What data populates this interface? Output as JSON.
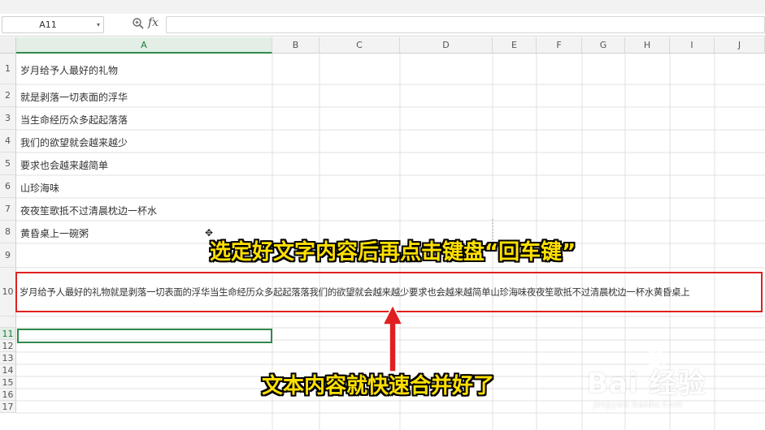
{
  "formula_bar": {
    "cell_ref": "A11",
    "fx_label": "fx"
  },
  "columns": [
    "A",
    "B",
    "C",
    "D",
    "E",
    "F",
    "G",
    "H",
    "I",
    "J"
  ],
  "rows": [
    "1",
    "2",
    "3",
    "4",
    "5",
    "6",
    "7",
    "8",
    "9",
    "10",
    "11",
    "12",
    "13",
    "14",
    "15",
    "16",
    "17"
  ],
  "cells": {
    "a1": "岁月给予人最好的礼物",
    "a2": "就是剥落一切表面的浮华",
    "a3": "当生命经历众多起起落落",
    "a4": "我们的欲望就会越来越少",
    "a5": "要求也会越来越简单",
    "a6": "山珍海味",
    "a7": "夜夜笙歌抵不过清晨枕边一杯水",
    "a8": "黄昏桌上一碗粥",
    "a10": "岁月给予人最好的礼物就是剥落一切表面的浮华当生命经历众多起起落落我们的欲望就会越来越少要求也会越来越简单山珍海味夜夜笙歌抵不过清晨枕边一杯水黄昏桌上"
  },
  "annotations": {
    "top_caption": "选定好文字内容后再点击键盘“回车键”",
    "bottom_caption": "文本内容就快速合并好了"
  },
  "watermark": {
    "brand": "Bai 经验",
    "url": "jingyan.baidu.com"
  },
  "colors": {
    "highlight_red": "#e02020",
    "caption_yellow": "#ffe000",
    "selection_green": "#2f8a4a"
  }
}
